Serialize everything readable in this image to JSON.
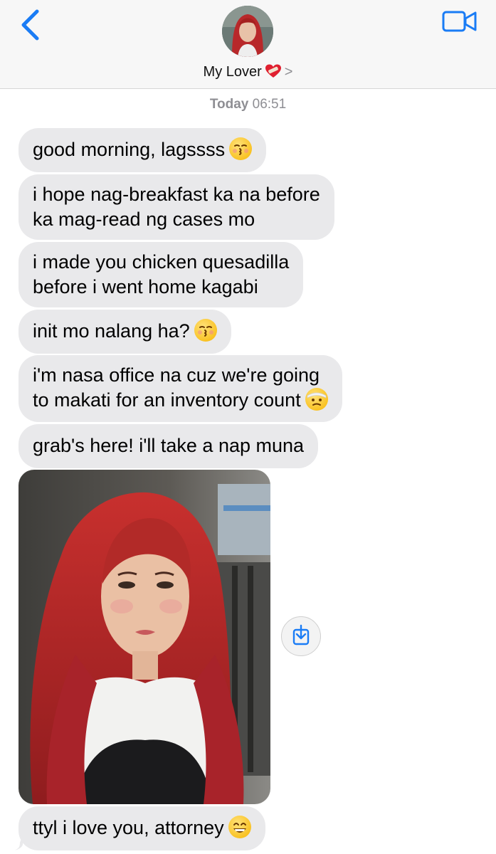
{
  "header": {
    "contact_name": "My Lover",
    "contact_emoji_icon": "heart-with-bandage",
    "chevron": ">"
  },
  "thread": {
    "date_label": "Today",
    "time_label": "06:51"
  },
  "messages": [
    {
      "text": "good morning, lagssss",
      "emoji": "kissing-face-icon"
    },
    {
      "text": "i hope nag-breakfast ka na before\nka mag-read ng cases mo",
      "emoji": ""
    },
    {
      "text": "i made you chicken quesadilla\nbefore i went home kagabi",
      "emoji": ""
    },
    {
      "text": "init mo nalang ha?",
      "emoji": "kissing-face-icon"
    },
    {
      "text": "i'm nasa office na cuz we're going\nto makati for an inventory count",
      "emoji": "face-with-head-bandage-icon"
    },
    {
      "text": "grab's here! i'll take a nap muna",
      "emoji": ""
    },
    {
      "text": "ttyl i love you, attorney",
      "emoji": "grinning-face-icon"
    }
  ],
  "colors": {
    "accent": "#1a7cf5",
    "incoming_bubble": "#e9e9eb",
    "timestamp": "#8e8e93"
  }
}
